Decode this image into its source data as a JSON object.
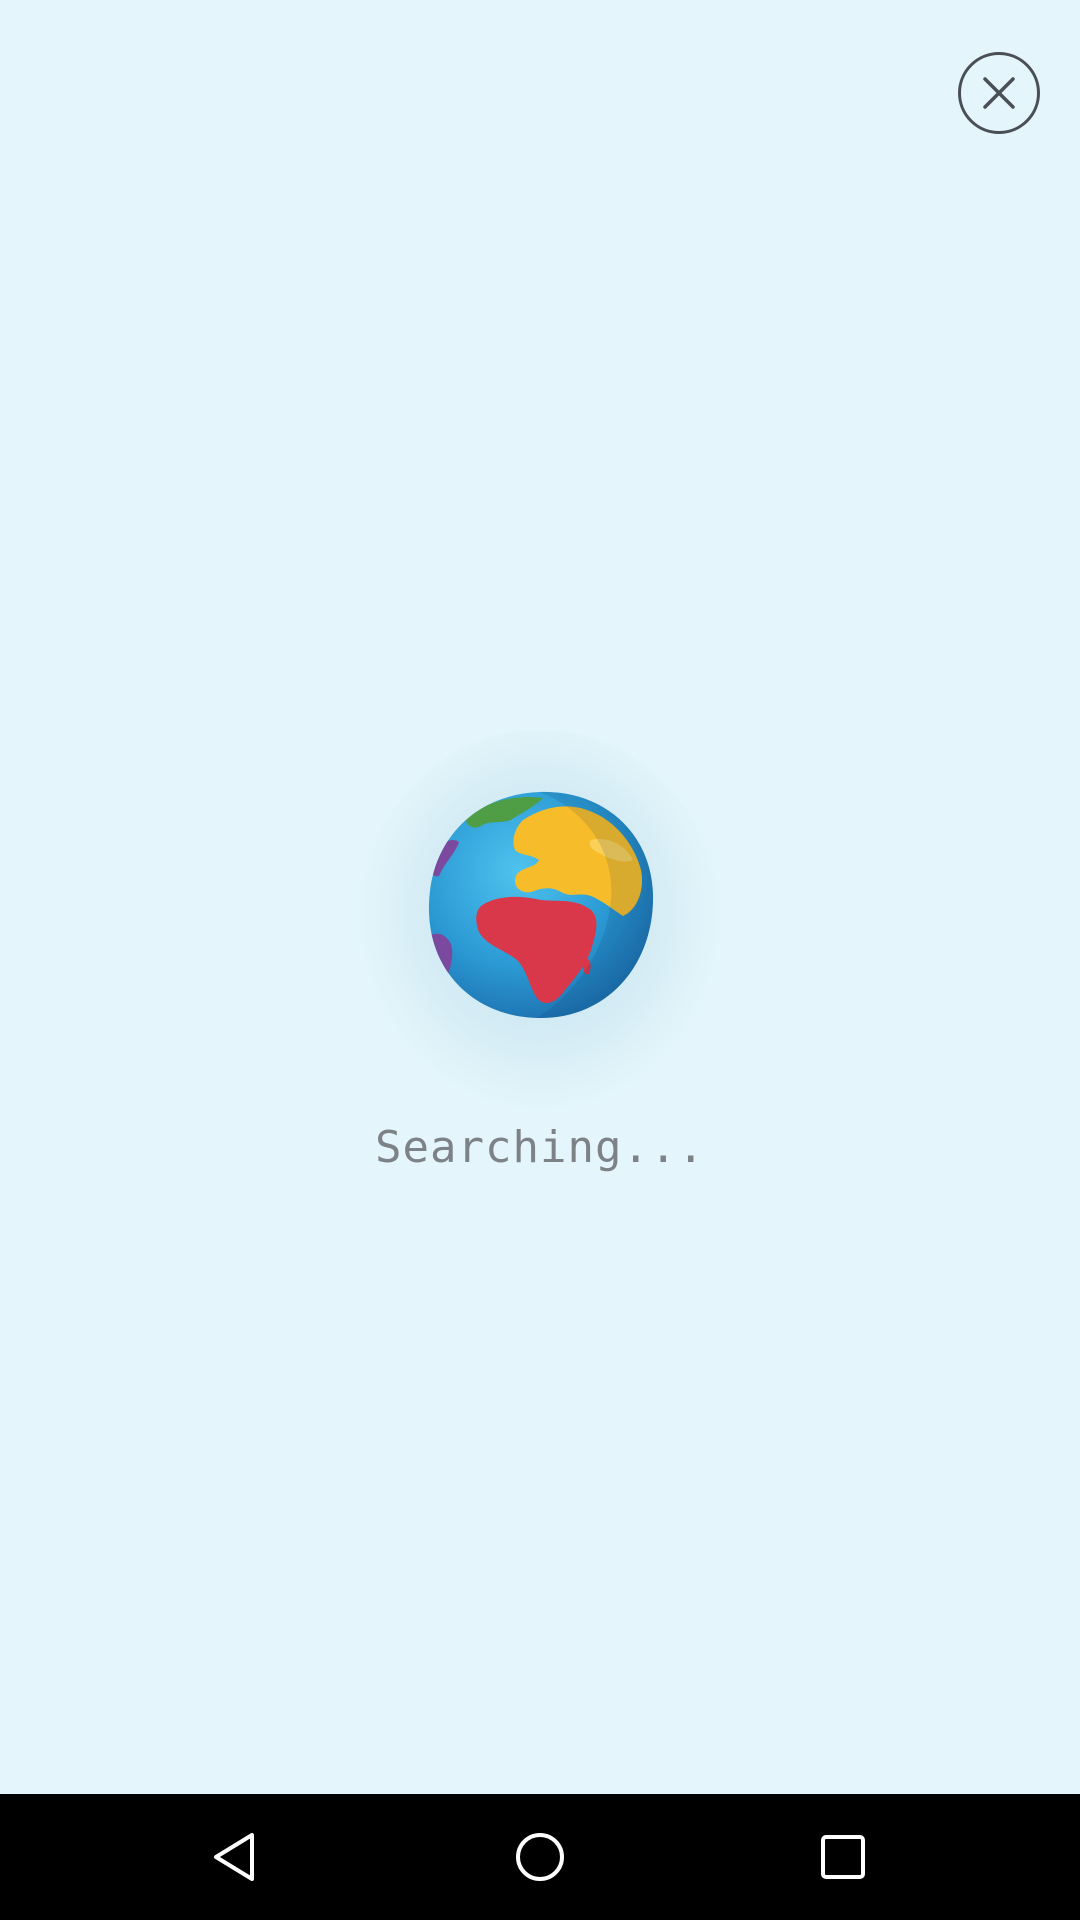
{
  "status": {
    "text": "Searching..."
  },
  "icons": {
    "close": "close-icon",
    "globe": "globe-icon",
    "back": "back-triangle-icon",
    "home": "home-circle-icon",
    "recents": "recents-square-icon"
  },
  "colors": {
    "background": "#e4f6fb",
    "ocean": "#2b9ad4",
    "africa": "#d8384a",
    "europe": "#f6bc2a",
    "north_america": "#4f9d45",
    "south_america": "#7b4a9e",
    "text": "#7d8287",
    "nav_bar": "#000000"
  }
}
